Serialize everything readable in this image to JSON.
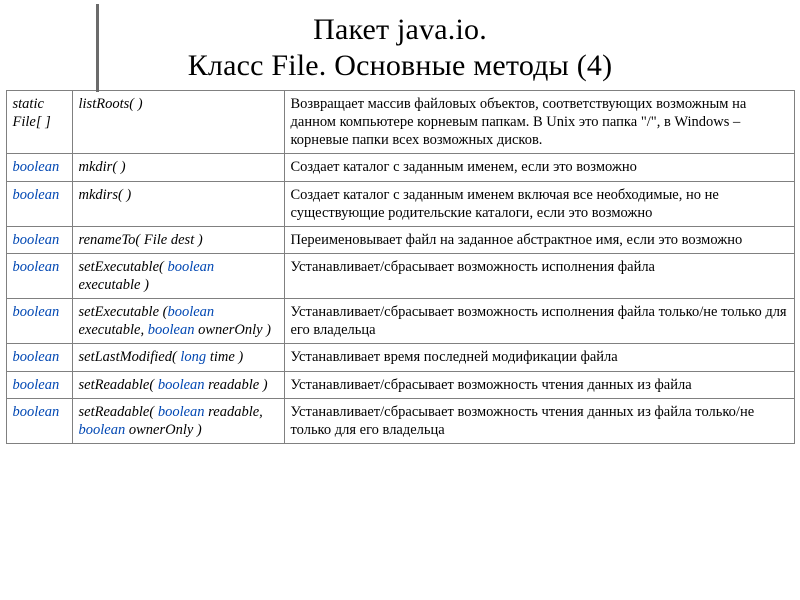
{
  "title": {
    "line1": "Пакет java.io.",
    "line2": "Класс File. Основные методы (4)"
  },
  "rows": [
    {
      "ret": [
        {
          "t": "static",
          "s": "plain"
        },
        {
          "t": "File[ ]",
          "s": "plain"
        }
      ],
      "sig": [
        {
          "t": "listRoots( )",
          "s": "it"
        }
      ],
      "desc": "Возвращает массив файловых объектов, соответствующих возможным на данном компьютере корневым папкам. В Unix это папка \"/\", в Windows – корневые папки всех возможных дисков."
    },
    {
      "ret": [
        {
          "t": "boolean",
          "s": "kw"
        }
      ],
      "sig": [
        {
          "t": "mkdir( )",
          "s": "it"
        }
      ],
      "desc": "Создает каталог с заданным именем, если это возможно"
    },
    {
      "ret": [
        {
          "t": "boolean",
          "s": "kw"
        }
      ],
      "sig": [
        {
          "t": "mkdirs( )",
          "s": "it"
        }
      ],
      "desc": "Создает каталог с заданным именем включая все необходимые, но не существующие родительские каталоги, если это возможно"
    },
    {
      "ret": [
        {
          "t": "boolean",
          "s": "kw"
        }
      ],
      "sig": [
        {
          "t": "renameTo( File dest )",
          "s": "it"
        }
      ],
      "desc": "Переименовывает файл на заданное абстрактное имя, если это возможно"
    },
    {
      "ret": [
        {
          "t": "boolean",
          "s": "kw"
        }
      ],
      "sig": [
        {
          "t": "setExecutable( ",
          "s": "it"
        },
        {
          "t": "boolean",
          "s": "kw"
        },
        {
          "t": " executable )",
          "s": "it"
        }
      ],
      "desc": "Устанавливает/сбрасывает возможность исполнения файла"
    },
    {
      "ret": [
        {
          "t": "boolean",
          "s": "kw"
        }
      ],
      "sig": [
        {
          "t": "setExecutable (",
          "s": "it"
        },
        {
          "t": "boolean",
          "s": "kw"
        },
        {
          "t": " executable, ",
          "s": "it"
        },
        {
          "t": "boolean",
          "s": "kw"
        },
        {
          "t": " ownerOnly )",
          "s": "it"
        }
      ],
      "desc": "Устанавливает/сбрасывает возможность исполнения файла только/не только для его владельца"
    },
    {
      "ret": [
        {
          "t": "boolean",
          "s": "kw"
        }
      ],
      "sig": [
        {
          "t": "setLastModified( ",
          "s": "it"
        },
        {
          "t": "long",
          "s": "kw"
        },
        {
          "t": " time )",
          "s": "it"
        }
      ],
      "desc": "Устанавливает время последней модификации файла"
    },
    {
      "ret": [
        {
          "t": "boolean",
          "s": "kw"
        }
      ],
      "sig": [
        {
          "t": "setReadable( ",
          "s": "it"
        },
        {
          "t": "boolean",
          "s": "kw"
        },
        {
          "t": " readable )",
          "s": "it"
        }
      ],
      "desc": "Устанавливает/сбрасывает возможность чтения данных из файла"
    },
    {
      "ret": [
        {
          "t": "boolean",
          "s": "kw"
        }
      ],
      "sig": [
        {
          "t": "setReadable( ",
          "s": "it"
        },
        {
          "t": "boolean",
          "s": "kw"
        },
        {
          "t": " readable, ",
          "s": "it"
        },
        {
          "t": "boolean",
          "s": "kw"
        },
        {
          "t": " ownerOnly )",
          "s": "it"
        }
      ],
      "desc": "Устанавливает/сбрасывает возможность чтения данных из файла только/не только для его владельца"
    }
  ]
}
